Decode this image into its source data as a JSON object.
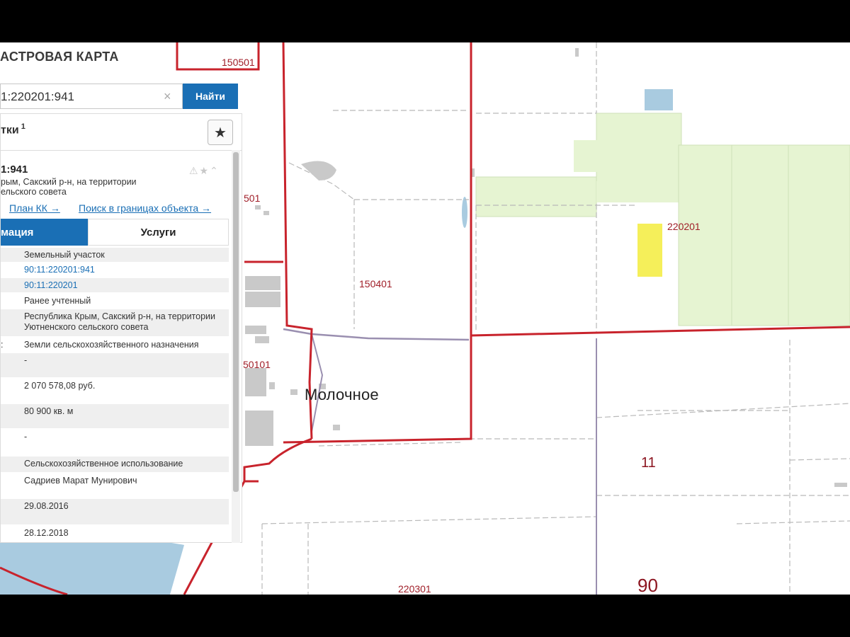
{
  "app": {
    "title": "АСТРОВАЯ КАРТА"
  },
  "search": {
    "value": "1:220201:941",
    "clear_icon": "×",
    "button_label": "Найти"
  },
  "results": {
    "title": "тки",
    "count": "1",
    "star_icon": "★"
  },
  "card": {
    "id": "1:941",
    "address_line1": "рым, Сакский р-н, на территории",
    "address_line2": "ельского совета",
    "icons": "⚠★⌃",
    "link_plan": "План КК →",
    "link_search": "Поиск в границах объекта →",
    "tab_info": "мация",
    "tab_services": "Услуги",
    "rows": [
      {
        "key": "",
        "value": "Земельный участок"
      },
      {
        "key": "",
        "value": "90:11:220201:941"
      },
      {
        "key": "",
        "value": "90:11:220201"
      },
      {
        "key": "",
        "value": "Ранее учтенный"
      },
      {
        "key": "",
        "value": "Республика Крым, Сакский р-н, на территории Уютненского сельского совета"
      },
      {
        "key": ":",
        "value": "Земли сельскохозяйственного назначения"
      },
      {
        "key": "",
        "value": "-"
      },
      {
        "key": "",
        "value": "2 070 578,08 руб."
      },
      {
        "key": "",
        "value": "80 900 кв. м"
      },
      {
        "key": "",
        "value": "-"
      },
      {
        "key": "",
        "value": "Сельскохозяйственное использование"
      },
      {
        "key": "",
        "value": "Садриев Марат Мунирович"
      },
      {
        "key": "",
        "value": "29.08.2016"
      },
      {
        "key": "",
        "value": "28.12.2018"
      }
    ]
  },
  "map": {
    "village": "Молочное",
    "labels": [
      "150501",
      "501",
      "150401",
      "220201",
      "50101",
      "11",
      "90",
      "220301"
    ],
    "colors": {
      "boundary": "#c8232c",
      "field_green": "#e6f4d2",
      "parcel_yellow": "#f5ef5a",
      "water": "#a9cbe0",
      "road": "#9a8fb0"
    }
  }
}
